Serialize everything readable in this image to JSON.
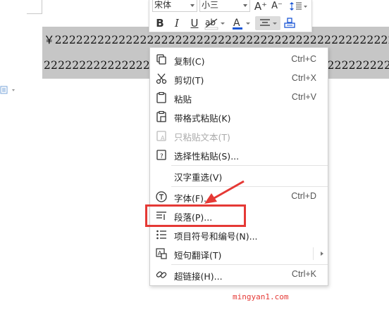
{
  "document": {
    "line1": "￥2222222222222222222222222222222222222222222222222222222222222222",
    "line2": "2222222222222222222222222222222222222222222222222222222222222222222"
  },
  "toolbar": {
    "font_name": "宋体",
    "font_size": "小三",
    "grow_label": "A⁺",
    "shrink_label": "A⁻",
    "bold_label": "B",
    "italic_label": "I",
    "underline_label": "U",
    "highlight_label": "ab",
    "fontcolor_label": "A",
    "fontcolor_color": "#1a56d6"
  },
  "menu": {
    "items": [
      {
        "label": "复制(C)",
        "shortcut": "Ctrl+C",
        "icon": "copy-icon"
      },
      {
        "label": "剪切(T)",
        "shortcut": "Ctrl+X",
        "icon": "scissors-icon"
      },
      {
        "label": "粘贴",
        "shortcut": "Ctrl+V",
        "icon": "paste-icon"
      },
      {
        "label": "带格式粘贴(K)",
        "shortcut": "",
        "icon": "paste-format-icon"
      },
      {
        "label": "只粘贴文本(T)",
        "shortcut": "",
        "icon": "paste-text-icon",
        "disabled": true
      },
      {
        "label": "选择性粘贴(S)...",
        "shortcut": "",
        "icon": "paste-special-icon"
      },
      {
        "label": "汉字重选(V)",
        "shortcut": "",
        "icon": ""
      },
      {
        "label": "字体(F)...",
        "shortcut": "Ctrl+D",
        "icon": "font-icon"
      },
      {
        "label": "段落(P)...",
        "shortcut": "",
        "icon": "paragraph-icon"
      },
      {
        "label": "项目符号和编号(N)...",
        "shortcut": "",
        "icon": "bullet-list-icon"
      },
      {
        "label": "短句翻译(T)",
        "shortcut": "",
        "icon": "translate-icon"
      },
      {
        "label": "超链接(H)...",
        "shortcut": "Ctrl+K",
        "icon": "link-icon"
      }
    ]
  },
  "annotation": {
    "color": "#e53935",
    "watermark": "mingyan1.com"
  }
}
